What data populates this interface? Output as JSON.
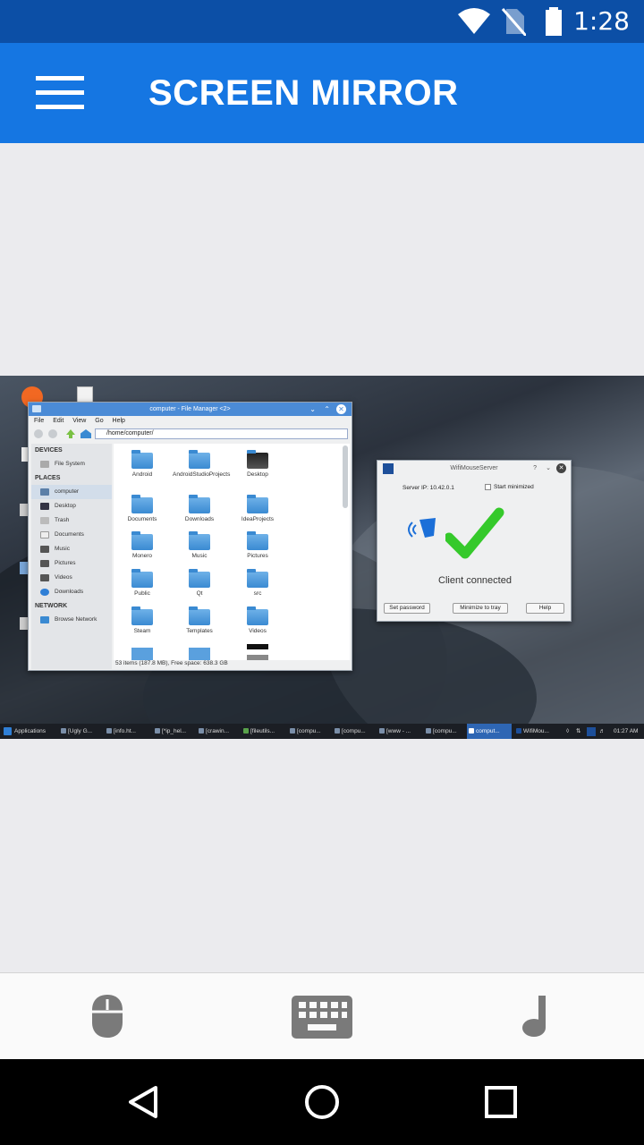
{
  "status_bar": {
    "time": "1:28",
    "icons": [
      "wifi-icon",
      "no-sim-icon",
      "battery-icon"
    ]
  },
  "app_bar": {
    "title": "SCREEN MIRROR",
    "menu_icon": "hamburger-icon"
  },
  "mirror": {
    "file_manager": {
      "title": "computer - File Manager <2>",
      "menu": [
        "File",
        "Edit",
        "View",
        "Go",
        "Help"
      ],
      "path": "/home/computer/",
      "sidebar": {
        "devices_header": "DEVICES",
        "devices": [
          "File System"
        ],
        "places_header": "PLACES",
        "places": [
          "computer",
          "Desktop",
          "Trash",
          "Documents",
          "Music",
          "Pictures",
          "Videos",
          "Downloads"
        ],
        "network_header": "NETWORK",
        "network": [
          "Browse Network"
        ]
      },
      "folders": [
        "Android",
        "AndroidStudioProjects",
        "Desktop",
        "Documents",
        "Downloads",
        "IdeaProjects",
        "Monero",
        "Music",
        "Pictures",
        "Public",
        "Qt",
        "src",
        "Steam",
        "Templates",
        "Videos"
      ],
      "status": "53 items (187.8 MB), Free space: 638.3 GB"
    },
    "wifimouse": {
      "title": "WifiMouseServer",
      "server_ip": "Server IP: 10.42.0.1",
      "start_minimized": "Start minimized",
      "status": "Client connected",
      "buttons": {
        "set_password": "Set password",
        "minimize": "Minimize to tray",
        "help": "Help"
      }
    },
    "taskbar": {
      "items": [
        "Applications",
        "[Ugly G...",
        "[info.ht...",
        "[*ip_hel...",
        "[crawin...",
        "[fileutils...",
        "[compu...",
        "[compu...",
        "[www - ...",
        "[compu...",
        "comput...",
        "WifiMou..."
      ],
      "clock": "01:27 AM"
    }
  },
  "controls": {
    "mouse": "mouse-icon",
    "keyboard": "keyboard-icon",
    "music": "music-note-icon"
  },
  "nav": {
    "back": "back-icon",
    "home": "home-icon",
    "recents": "recents-icon"
  },
  "colors": {
    "status_bar": "#0c4fa6",
    "app_bar": "#1576e2",
    "background": "#ebebee",
    "check_green": "#35c92b"
  }
}
